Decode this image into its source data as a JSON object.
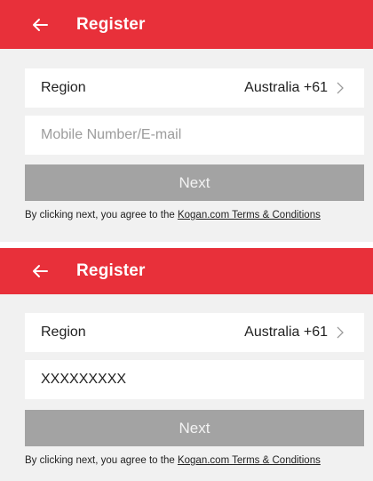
{
  "screens": [
    {
      "title": "Register",
      "region_label": "Region",
      "region_value": "Australia +61",
      "input_value": "",
      "input_placeholder": "Mobile Number/E-mail",
      "next_label": "Next",
      "terms_prefix": "By clicking next, you agree to the ",
      "terms_link": "Kogan.com Terms & Conditions"
    },
    {
      "title": "Register",
      "region_label": "Region",
      "region_value": "Australia +61",
      "input_value": "XXXXXXXXX",
      "input_placeholder": "",
      "next_label": "Next",
      "terms_prefix": "By clicking next, you agree to the ",
      "terms_link": "Kogan.com Terms & Conditions"
    }
  ],
  "colors": {
    "header": "#e8303a",
    "background": "#f1f1f1",
    "button_disabled": "#a3a3a3"
  },
  "icons": {
    "back": "arrow-left-icon",
    "chevron": "chevron-right-icon"
  }
}
